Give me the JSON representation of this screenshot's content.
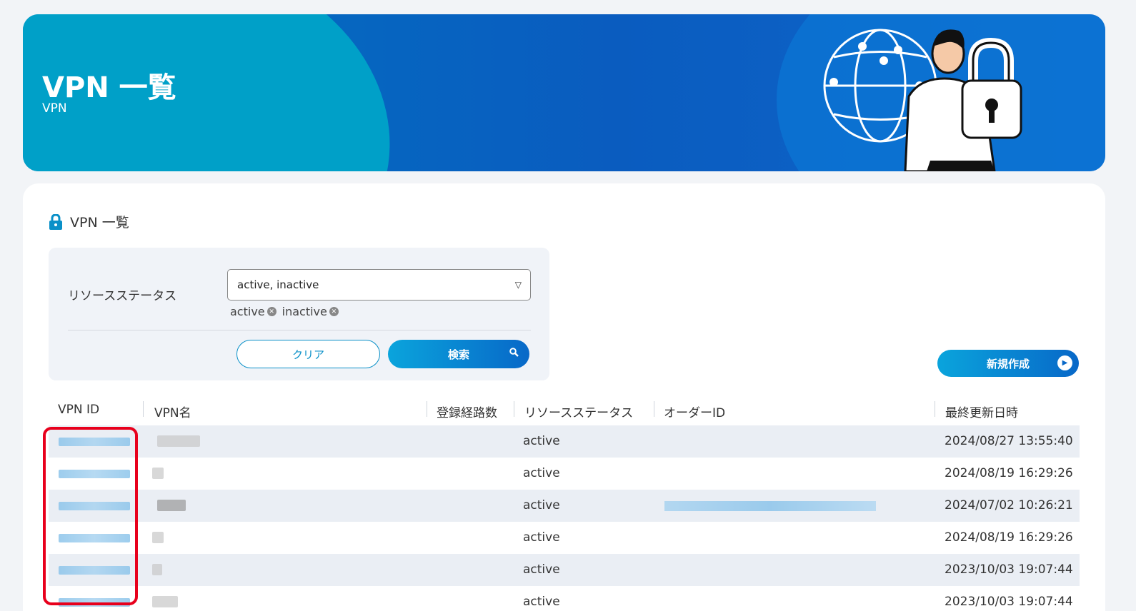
{
  "banner": {
    "title": "VPN 一覧",
    "subtitle": "VPN"
  },
  "card": {
    "title": "VPN 一覧",
    "title_icon": "lock-icon"
  },
  "filter": {
    "label": "リソースステータス",
    "select_value": "active, inactive",
    "chips": [
      "active",
      "inactive"
    ],
    "clear_label": "クリア",
    "search_label": "検索"
  },
  "new_button_label": "新規作成",
  "table": {
    "headers": [
      "VPN ID",
      "VPN名",
      "登録経路数",
      "リソースステータス",
      "オーダーID",
      "最終更新日時"
    ],
    "rows": [
      {
        "status": "active",
        "updated": "2024/08/27 13:55:40"
      },
      {
        "status": "active",
        "updated": "2024/08/19 16:29:26"
      },
      {
        "status": "active",
        "updated": "2024/07/02 10:26:21"
      },
      {
        "status": "active",
        "updated": "2024/08/19 16:29:26"
      },
      {
        "status": "active",
        "updated": "2023/10/03 19:07:44"
      },
      {
        "status": "active",
        "updated": "2023/10/03 19:07:44"
      }
    ]
  },
  "colors": {
    "accent": "#0a90c8",
    "highlight": "#e8001c",
    "banner": "#0a5cbf"
  }
}
